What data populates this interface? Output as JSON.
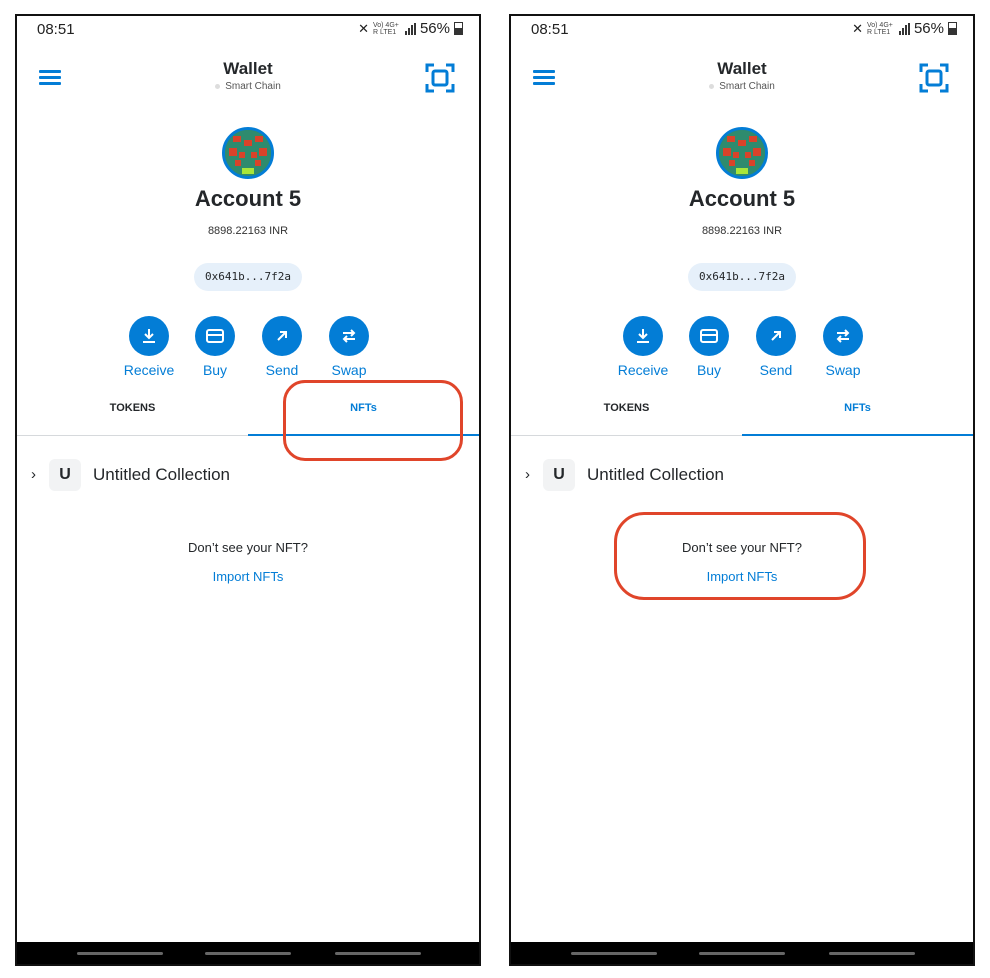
{
  "screens": [
    {
      "status": {
        "time": "08:51",
        "battery": "56%",
        "network": "Vo) 4G+ R LTE1"
      },
      "header": {
        "title": "Wallet",
        "network": "Smart Chain"
      },
      "account": {
        "name": "Account 5",
        "balance": "8898.22163 INR",
        "address": "0x641b...7f2a"
      },
      "actions": [
        "Receive",
        "Buy",
        "Send",
        "Swap"
      ],
      "tabs": {
        "tokens": "TOKENS",
        "nfts": "NFTs",
        "active": "NFTs"
      },
      "collection": {
        "badge": "U",
        "name": "Untitled Collection"
      },
      "nft_help": {
        "question": "Don’t see your NFT?",
        "import": "Import NFTs"
      },
      "highlight": "nfts-tab"
    },
    {
      "status": {
        "time": "08:51",
        "battery": "56%",
        "network": "Vo) 4G+ R LTE1"
      },
      "header": {
        "title": "Wallet",
        "network": "Smart Chain"
      },
      "account": {
        "name": "Account 5",
        "balance": "8898.22163 INR",
        "address": "0x641b...7f2a"
      },
      "actions": [
        "Receive",
        "Buy",
        "Send",
        "Swap"
      ],
      "tabs": {
        "tokens": "TOKENS",
        "nfts": "NFTs",
        "active": "NFTs"
      },
      "collection": {
        "badge": "U",
        "name": "Untitled Collection"
      },
      "nft_help": {
        "question": "Don’t see your NFT?",
        "import": "Import NFTs"
      },
      "highlight": "import-nfts"
    }
  ],
  "colors": {
    "accent": "#037dd6",
    "highlight": "#e0452a",
    "text": "#24272a"
  },
  "icons": {
    "menu": "hamburger-icon",
    "scan": "qr-scan-icon",
    "receive": "download-arrow-icon",
    "buy": "card-icon",
    "send": "arrow-up-right-icon",
    "swap": "swap-arrows-icon"
  }
}
